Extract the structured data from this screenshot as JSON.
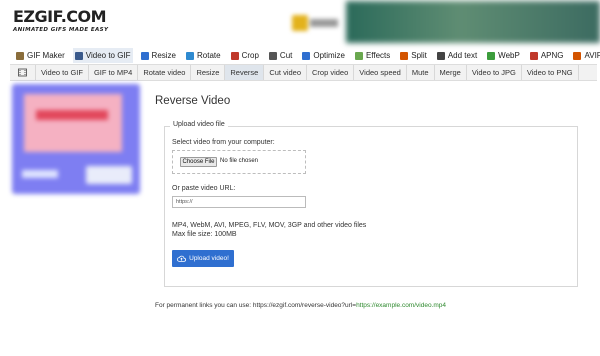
{
  "brand": {
    "name": "EZGIF.COM",
    "tagline": "ANIMATED GIFS MADE EASY"
  },
  "main_menu": [
    {
      "label": "GIF Maker",
      "icon": "gif-maker-icon",
      "color": "#8a6d3b",
      "active": false
    },
    {
      "label": "Video to GIF",
      "icon": "video-to-gif-icon",
      "color": "#3a5a8c",
      "active": true
    },
    {
      "label": "Resize",
      "icon": "resize-icon",
      "color": "#2f6fd0",
      "active": false
    },
    {
      "label": "Rotate",
      "icon": "rotate-icon",
      "color": "#2f8ad0",
      "active": false
    },
    {
      "label": "Crop",
      "icon": "crop-icon",
      "color": "#c0392b",
      "active": false
    },
    {
      "label": "Cut",
      "icon": "cut-icon",
      "color": "#555555",
      "active": false
    },
    {
      "label": "Optimize",
      "icon": "optimize-icon",
      "color": "#2f6fd0",
      "active": false
    },
    {
      "label": "Effects",
      "icon": "effects-icon",
      "color": "#6aa84f",
      "active": false
    },
    {
      "label": "Split",
      "icon": "split-icon",
      "color": "#d35400",
      "active": false
    },
    {
      "label": "Add text",
      "icon": "add-text-icon",
      "color": "#444444",
      "active": false
    },
    {
      "label": "WebP",
      "icon": "webp-icon",
      "color": "#3c9d3c",
      "active": false
    },
    {
      "label": "APNG",
      "icon": "apng-icon",
      "color": "#c0392b",
      "active": false
    },
    {
      "label": "AVIF",
      "icon": "avif-icon",
      "color": "#d35400",
      "active": false
    }
  ],
  "sub_menu": [
    {
      "label": "Video to GIF",
      "active": false
    },
    {
      "label": "GIF to MP4",
      "active": false
    },
    {
      "label": "Rotate video",
      "active": false
    },
    {
      "label": "Resize",
      "active": false
    },
    {
      "label": "Reverse",
      "active": true
    },
    {
      "label": "Cut video",
      "active": false
    },
    {
      "label": "Crop video",
      "active": false
    },
    {
      "label": "Video speed",
      "active": false
    },
    {
      "label": "Mute",
      "active": false
    },
    {
      "label": "Merge",
      "active": false
    },
    {
      "label": "Video to JPG",
      "active": false
    },
    {
      "label": "Video to PNG",
      "active": false
    }
  ],
  "page": {
    "title": "Reverse Video",
    "upload_legend": "Upload video file",
    "select_label": "Select video from your computer:",
    "choose_file": "Choose File",
    "no_file": "No file chosen",
    "url_label": "Or paste video URL:",
    "url_value": "https://",
    "formats": "MP4, WebM, AVI, MPEG, FLV, MOV, 3GP and other video files",
    "max_size": "Max file size: 100MB",
    "upload_button": "Upload video!",
    "permalink_prefix": "For permanent links you can use: https://ezgif.com/reverse-video?url=",
    "permalink_example": "https://example.com/video.mp4"
  },
  "colors": {
    "accent": "#2f6fd0",
    "link": "#2f8a2f"
  }
}
